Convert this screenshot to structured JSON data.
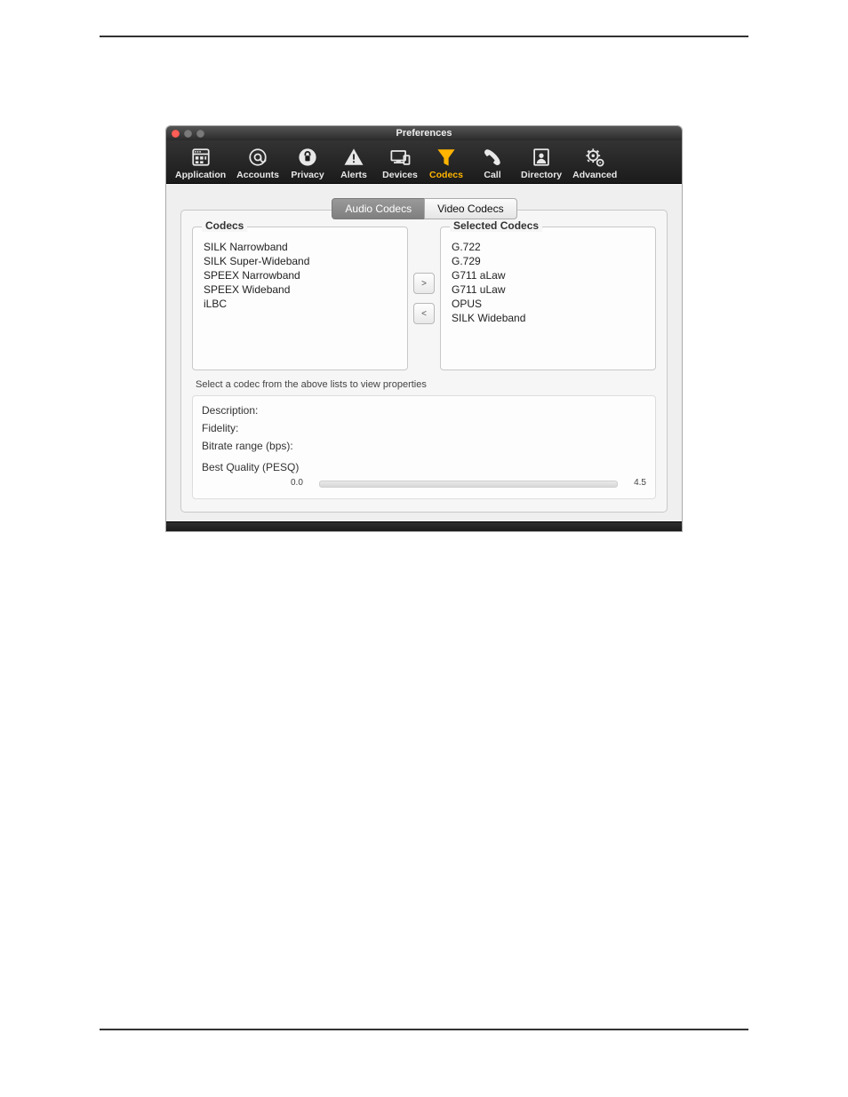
{
  "window": {
    "title": "Preferences",
    "traffic": [
      "red",
      "gray",
      "gray"
    ]
  },
  "toolbar": {
    "items": [
      {
        "name": "application",
        "label": "Application"
      },
      {
        "name": "accounts",
        "label": "Accounts"
      },
      {
        "name": "privacy",
        "label": "Privacy"
      },
      {
        "name": "alerts",
        "label": "Alerts"
      },
      {
        "name": "devices",
        "label": "Devices"
      },
      {
        "name": "codecs",
        "label": "Codecs",
        "selected": true
      },
      {
        "name": "call",
        "label": "Call"
      },
      {
        "name": "directory",
        "label": "Directory"
      },
      {
        "name": "advanced",
        "label": "Advanced"
      }
    ]
  },
  "tabs": {
    "items": [
      {
        "name": "audio-codecs",
        "label": "Audio Codecs",
        "active": true
      },
      {
        "name": "video-codecs",
        "label": "Video Codecs"
      }
    ]
  },
  "codecs": {
    "available_title": "Codecs",
    "available": [
      "SILK Narrowband",
      "SILK Super-Wideband",
      "SPEEX Narrowband",
      "SPEEX Wideband",
      "iLBC"
    ],
    "selected_title": "Selected Codecs",
    "selected": [
      "G.722",
      "G.729",
      "G711 aLaw",
      "G711 uLaw",
      "OPUS",
      "SILK Wideband"
    ],
    "move_right": ">",
    "move_left": "<"
  },
  "hint": "Select a codec from the above lists to view properties",
  "properties": {
    "description_label": "Description:",
    "fidelity_label": "Fidelity:",
    "bitrate_label": "Bitrate range (bps):",
    "pesq_label": "Best Quality (PESQ)",
    "pesq_min": "0.0",
    "pesq_max": "4.5"
  }
}
